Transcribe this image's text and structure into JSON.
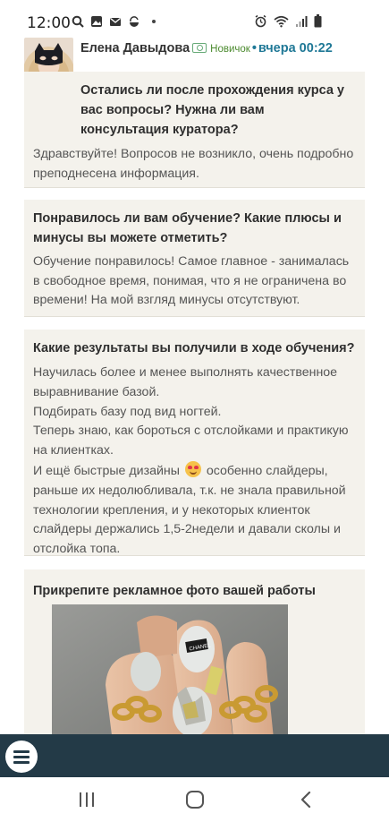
{
  "status_bar": {
    "time": "12:00",
    "left_icons": [
      "search-icon",
      "gallery-icon",
      "gmail-icon",
      "sync-icon"
    ],
    "right_icons": [
      "alarm-icon",
      "wifi-icon",
      "signal-icon",
      "battery-icon"
    ]
  },
  "author": {
    "name": "Елена Давыдова",
    "level": "Новичок",
    "separator": "•",
    "time": "вчера 00:22"
  },
  "qa": [
    {
      "question": "Остались ли после прохождения курса у вас вопросы? Нужна ли вам консультация куратора?",
      "answer": "Здравствуйте! Вопросов не возникло, очень подробно преподнесена информация."
    },
    {
      "question": "Понравилось ли вам обучение? Какие плюсы и минусы вы можете отметить?",
      "answer": "Обучение понравилось! Самое главное - занималась в свободное время, понимая, что я не ограничена во времени! На мой взгляд минусы отсутствуют."
    },
    {
      "question": "Какие результаты вы получили в ходе обучения?",
      "answer_lines": [
        "Научилась более и менее выполнять качественное выравнивание базой.",
        "Подбирать базу под вид ногтей.",
        "Теперь знаю, как бороться с отслойками и практикую на клиентках.",
        "И ещё быстрые дизайны",
        "особенно слайдеры, раньше их недолюбливала, т.к. не знала правильной технологии крепления, и у некоторых клиенток слайдеры держались 1,5-2недели и давали сколы и отслойка топа."
      ]
    },
    {
      "question": "Прикрепите рекламное фото вашей работы"
    }
  ],
  "photo": {
    "label": "Nail work photo",
    "nail_text": "CHANEL"
  },
  "bottom_bar": {
    "menu_icon": "hamburger-menu-icon"
  },
  "android_nav": {
    "icons": [
      "recents-icon",
      "home-icon",
      "back-icon"
    ]
  },
  "colors": {
    "card_bg": "#f4f2ec",
    "accent_blue": "#1f7896",
    "level_green": "#4b8a2e",
    "bottom_bar": "#233a47"
  }
}
